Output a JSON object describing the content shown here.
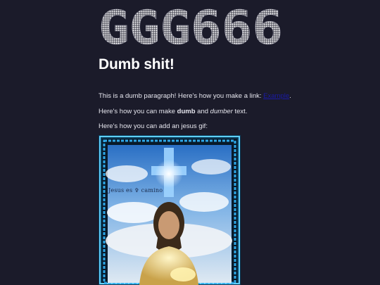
{
  "banner": {
    "text": "GGG666"
  },
  "heading": "Dumb shit!",
  "paragraph1": {
    "before": "This is a dumb paragraph! Here's how you make a link: ",
    "link_text": "Example",
    "after": "."
  },
  "paragraph2": {
    "before": "Here's how you can make ",
    "bold": "dumb",
    "middle": " and ",
    "italic": "dumber",
    "after": " text."
  },
  "paragraph3": {
    "text": "Here's how you can add an jesus gif:"
  },
  "gif": {
    "caption": "Jesus es ✞ camino"
  },
  "colors": {
    "background": "#1b1b2a",
    "link": "#1a1aa6",
    "text": "#ffffff"
  }
}
